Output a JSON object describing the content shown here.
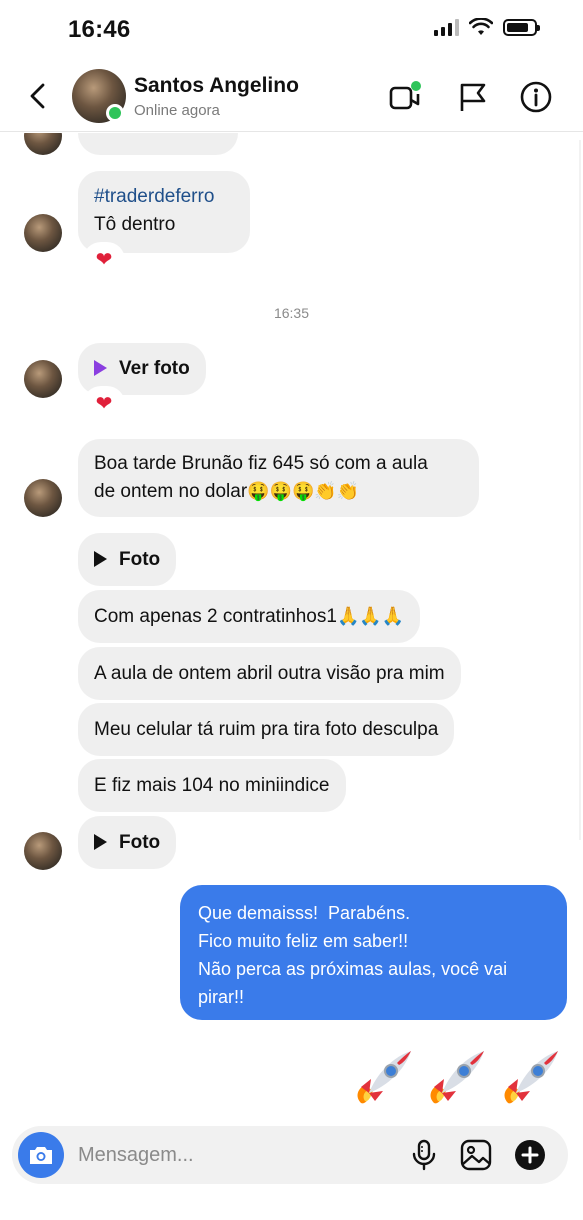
{
  "status_bar": {
    "time": "16:46"
  },
  "header": {
    "contact_name": "Santos Angelino",
    "contact_status": "Online agora",
    "icons": [
      "back-chevron-icon",
      "video-call-icon",
      "flag-icon",
      "info-icon"
    ]
  },
  "messages": {
    "m1_hashtag": "#traderdeferro",
    "m1_text": "Tô dentro",
    "time_divider": "16:35",
    "m2_label": "Ver foto",
    "m3_line1": "Boa tarde Brunão fiz 645 só com a aula",
    "m3_line2": "de ontem no dolar",
    "m3_emojis": "🤑🤑🤑👏👏",
    "m4_label": "Foto",
    "m5_text": "Com apenas 2 contratinhos1",
    "m5_emojis": "🙏🙏🙏",
    "m6_text": "A aula de ontem abril outra visão pra mim",
    "m7_text": "Meu celular tá ruim pra tira foto desculpa",
    "m8_text": "E fiz mais 104 no miniindice",
    "m9_label": "Foto",
    "reply_text": "Que demaisss!  Parabéns.\nFico muito feliz em saber!!\nNão perca as próximas aulas, você vai pirar!!",
    "reaction": "❤️"
  },
  "composer": {
    "placeholder": "Mensagem..."
  },
  "colors": {
    "accent": "#3a7bea",
    "bubble_in": "#efefef",
    "online": "#2fc45a",
    "heart": "#e0203a"
  }
}
